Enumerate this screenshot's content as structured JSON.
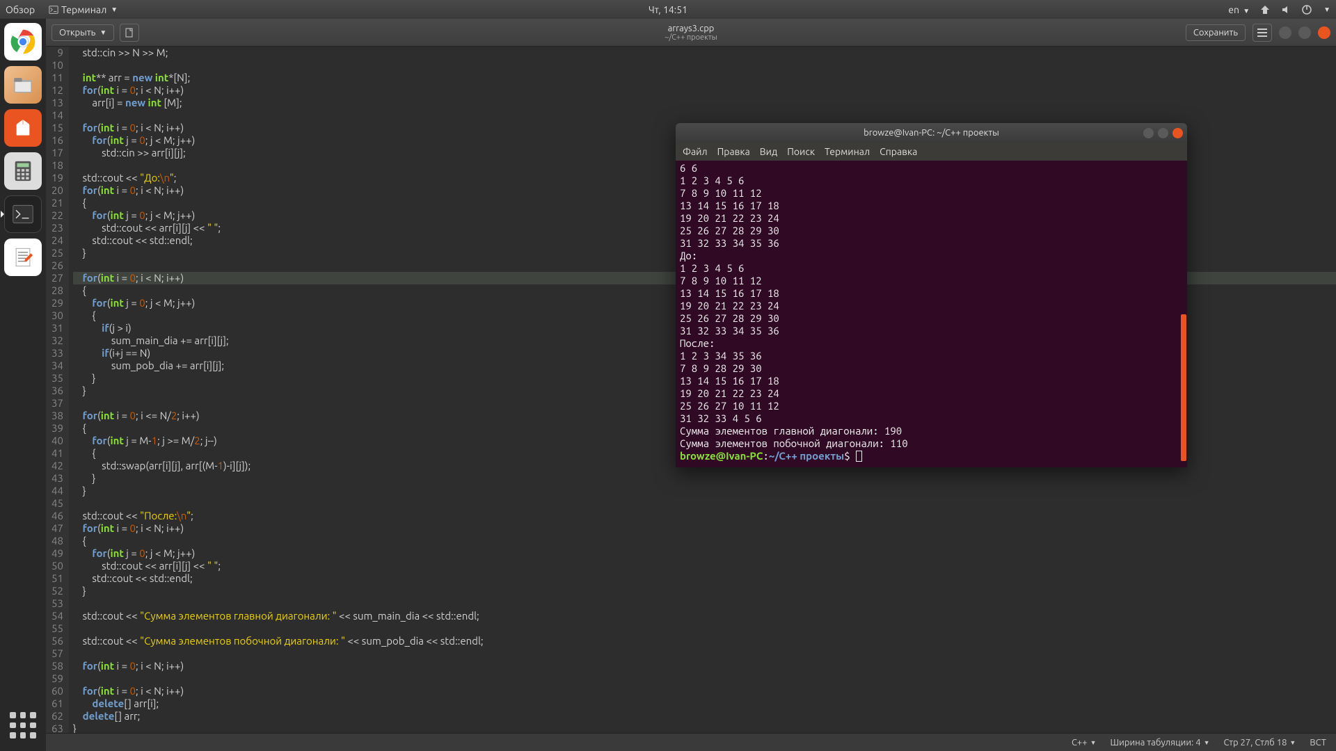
{
  "panel": {
    "obzor": "Обзор",
    "app_menu": "Терминал",
    "clock": "Чт, 14:51",
    "lang": "en"
  },
  "launcher": {
    "items": [
      "chrome",
      "files",
      "software",
      "calculator",
      "terminal",
      "text-editor"
    ]
  },
  "gedit": {
    "open": "Открыть",
    "save": "Сохранить",
    "title": "arrays3.cpp",
    "subtitle": "~/C++ проекты",
    "status": {
      "lang": "C++",
      "tab": "Ширина табуляции: 4",
      "pos": "Стр 27, Стлб 18",
      "ins": "ВСТ"
    },
    "first_line": 9,
    "highlight_line": 27,
    "code": [
      "    std::cin >> N >> M;",
      "",
      "    int** arr = new int*[N];",
      "    for(int i = 0; i < N; i++)",
      "        arr[i] = new int [M];",
      "",
      "    for(int i = 0; i < N; i++)",
      "        for(int j = 0; j < M; j++)",
      "            std::cin >> arr[i][j];",
      "",
      "    std::cout << \"До:\\n\";",
      "    for(int i = 0; i < N; i++)",
      "    {",
      "        for(int j = 0; j < M; j++)",
      "            std::cout << arr[i][j] << \" \";",
      "        std::cout << std::endl;",
      "    }",
      "",
      "    for(int i = 0; i < N; i++)",
      "    {",
      "        for(int j = 0; j < M; j++)",
      "        {",
      "            if(j > i)",
      "                sum_main_dia += arr[i][j];",
      "            if(i+j == N)",
      "                sum_pob_dia += arr[i][j];",
      "        }",
      "    }",
      "",
      "    for(int i = 0; i <= N/2; i++)",
      "    {",
      "        for(int j = M-1; j >= M/2; j--)",
      "        {",
      "            std::swap(arr[i][j], arr[(M-1)-i][j]);",
      "        }",
      "    }",
      "",
      "    std::cout << \"После:\\n\";",
      "    for(int i = 0; i < N; i++)",
      "    {",
      "        for(int j = 0; j < M; j++)",
      "            std::cout << arr[i][j] << \" \";",
      "        std::cout << std::endl;",
      "    }",
      "",
      "    std::cout << \"Сумма элементов главной диагонали: \" << sum_main_dia << std::endl;",
      "",
      "    std::cout << \"Сумма элементов побочной диагонали: \" << sum_pob_dia << std::endl;",
      "",
      "    for(int i = 0; i < N; i++)",
      "",
      "    for(int i = 0; i < N; i++)",
      "        delete[] arr[i];",
      "    delete[] arr;",
      "}"
    ]
  },
  "terminal": {
    "title": "browze@Ivan-PC: ~/C++ проекты",
    "menu": [
      "Файл",
      "Правка",
      "Вид",
      "Поиск",
      "Терминал",
      "Справка"
    ],
    "output": [
      "6 6",
      "1 2 3 4 5 6",
      "7 8 9 10 11 12",
      "13 14 15 16 17 18",
      "19 20 21 22 23 24",
      "25 26 27 28 29 30",
      "31 32 33 34 35 36",
      "До:",
      "1 2 3 4 5 6 ",
      "7 8 9 10 11 12 ",
      "13 14 15 16 17 18 ",
      "19 20 21 22 23 24 ",
      "25 26 27 28 29 30 ",
      "31 32 33 34 35 36 ",
      "После:",
      "1 2 3 34 35 36 ",
      "7 8 9 28 29 30 ",
      "13 14 15 16 17 18 ",
      "19 20 21 22 23 24 ",
      "25 26 27 10 11 12 ",
      "31 32 33 4 5 6 ",
      "Сумма элементов главной диагонали: 190",
      "Сумма элементов побочной диагонали: 110"
    ],
    "prompt_user": "browze@Ivan-PC",
    "prompt_path": "~/C++ проекты"
  }
}
